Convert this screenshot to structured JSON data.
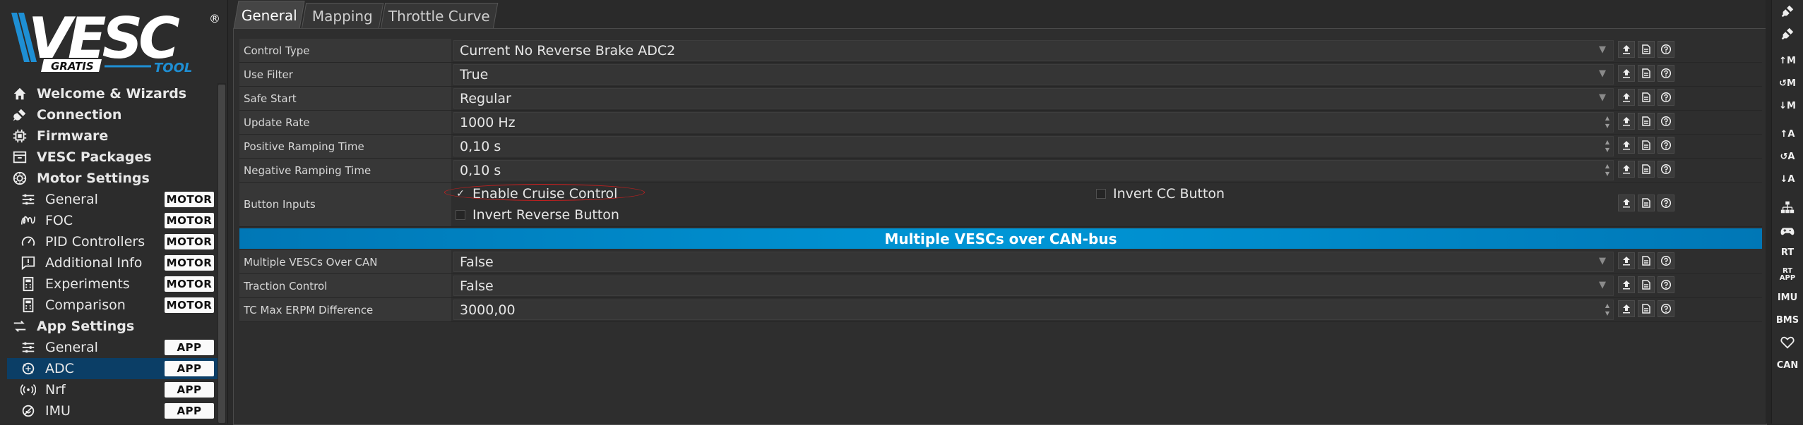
{
  "logo": {
    "text": "VESC",
    "registered": "®",
    "gratis": "GRATIS",
    "tool": "TOOL"
  },
  "sidebar": {
    "items": [
      {
        "label": "Welcome & Wizards",
        "level": "top",
        "icon": "home-icon"
      },
      {
        "label": "Connection",
        "level": "top",
        "icon": "plug-icon"
      },
      {
        "label": "Firmware",
        "level": "top",
        "icon": "chip-icon"
      },
      {
        "label": "VESC Packages",
        "level": "top",
        "icon": "package-icon"
      },
      {
        "label": "Motor Settings",
        "level": "top",
        "icon": "motor-icon"
      },
      {
        "label": "General",
        "level": "sub",
        "icon": "sliders-icon",
        "badge": "MOTOR"
      },
      {
        "label": "FOC",
        "level": "sub",
        "icon": "coil-icon",
        "badge": "MOTOR"
      },
      {
        "label": "PID Controllers",
        "level": "sub",
        "icon": "gauge-icon",
        "badge": "MOTOR"
      },
      {
        "label": "Additional Info",
        "level": "sub",
        "icon": "info-icon",
        "badge": "MOTOR"
      },
      {
        "label": "Experiments",
        "level": "sub",
        "icon": "calculator-icon",
        "badge": "MOTOR"
      },
      {
        "label": "Comparison",
        "level": "sub",
        "icon": "calculator-icon",
        "badge": "MOTOR"
      },
      {
        "label": "App Settings",
        "level": "top",
        "icon": "app-settings-icon"
      },
      {
        "label": "General",
        "level": "sub",
        "icon": "sliders-icon",
        "badge": "APP"
      },
      {
        "label": "ADC",
        "level": "sub",
        "icon": "adc-icon",
        "badge": "APP",
        "selected": true
      },
      {
        "label": "Nrf",
        "level": "sub",
        "icon": "wireless-icon",
        "badge": "APP"
      },
      {
        "label": "IMU",
        "level": "sub",
        "icon": "imu-icon",
        "badge": "APP"
      }
    ]
  },
  "tabs": [
    {
      "label": "General",
      "active": true
    },
    {
      "label": "Mapping",
      "active": false
    },
    {
      "label": "Throttle Curve",
      "active": false
    }
  ],
  "params": {
    "control_type": {
      "label": "Control Type",
      "value": "Current No Reverse Brake ADC2"
    },
    "use_filter": {
      "label": "Use Filter",
      "value": "True"
    },
    "safe_start": {
      "label": "Safe Start",
      "value": "Regular"
    },
    "update_rate": {
      "label": "Update Rate",
      "value": "1000 Hz"
    },
    "pos_ramp": {
      "label": "Positive Ramping Time",
      "value": "0,10 s"
    },
    "neg_ramp": {
      "label": "Negative Ramping Time",
      "value": "0,10 s"
    },
    "button_inputs": {
      "label": "Button Inputs",
      "enable_cruise": {
        "label": "Enable Cruise Control",
        "checked": true
      },
      "invert_cc": {
        "label": "Invert CC Button",
        "checked": false
      },
      "invert_reverse": {
        "label": "Invert Reverse Button",
        "checked": false
      }
    },
    "section_can": "Multiple VESCs over CAN-bus",
    "multi_can": {
      "label": "Multiple VESCs Over CAN",
      "value": "False"
    },
    "traction": {
      "label": "Traction Control",
      "value": "False"
    },
    "tc_erpm": {
      "label": "TC Max ERPM Difference",
      "value": "3000,00"
    }
  },
  "glyphs": {
    "check": "✓",
    "caret": "▼",
    "spin_up": "▲",
    "spin_down": "▼"
  },
  "rightbar": {
    "buttons": [
      {
        "icon": "key-icon",
        "text": ""
      },
      {
        "icon": "key-icon",
        "text": ""
      },
      {
        "icon": "read-motor-icon",
        "text": "↑M"
      },
      {
        "icon": "motor-default-icon",
        "text": "↺M"
      },
      {
        "icon": "write-motor-icon",
        "text": "↓M"
      },
      {
        "icon": "read-app-icon",
        "text": "↑A"
      },
      {
        "icon": "app-default-icon",
        "text": "↺A"
      },
      {
        "icon": "write-app-icon",
        "text": "↓A"
      },
      {
        "icon": "network-icon",
        "text": ""
      },
      {
        "icon": "gamepad-icon",
        "text": ""
      },
      {
        "icon": "rt-data-icon",
        "text": "RT"
      },
      {
        "icon": "rt-app-icon",
        "text": "RT\nAPP"
      },
      {
        "icon": "imu-data-icon",
        "text": "IMU"
      },
      {
        "icon": "bms-icon",
        "text": "BMS"
      },
      {
        "icon": "heart-icon",
        "text": ""
      },
      {
        "icon": "can-icon",
        "text": "CAN"
      }
    ]
  }
}
